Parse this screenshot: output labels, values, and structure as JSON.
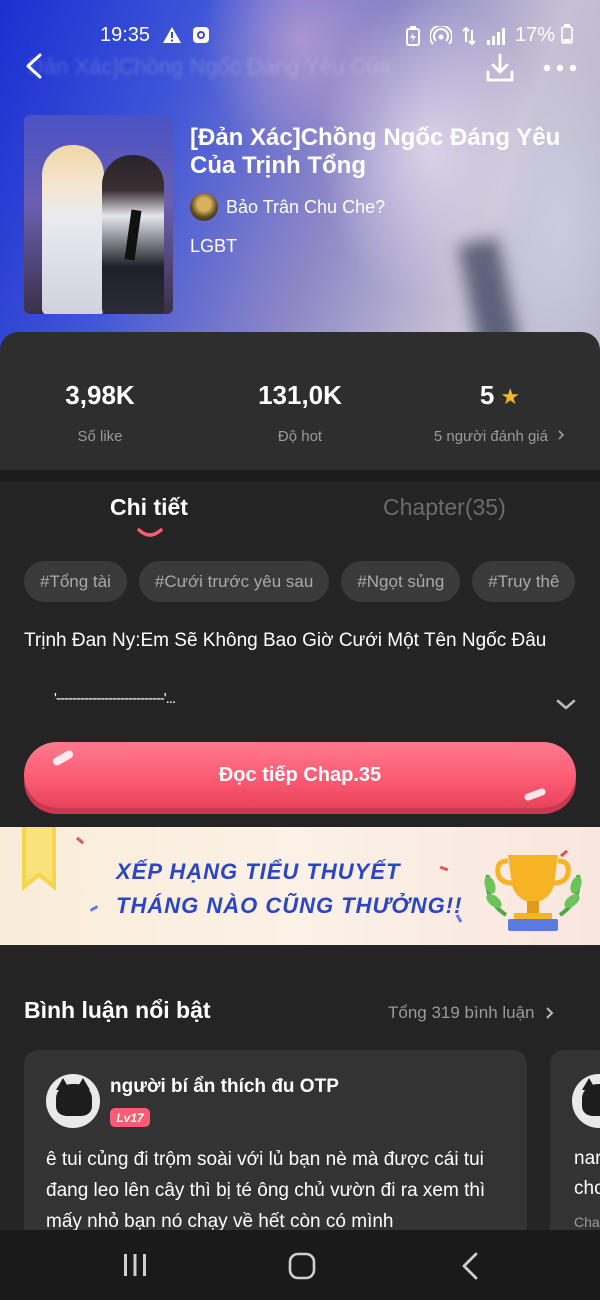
{
  "status_bar": {
    "time": "19:35",
    "battery": "17%",
    "icons": [
      "warning-icon",
      "notification-icon",
      "battery-saver-icon",
      "hotspot-icon",
      "data-icon",
      "signal-icon"
    ]
  },
  "header_ghost_title": "Đản Xác]Chồng Ngốc Đáng Yêu Của",
  "story": {
    "title": "[Đản Xác]Chồng Ngốc Đáng Yêu Của Trịnh Tổng",
    "author": "Bảo Trân Chu Che?",
    "genre": "LGBT"
  },
  "stats": {
    "likes_value": "3,98K",
    "likes_label": "Số like",
    "hot_value": "131,0K",
    "hot_label": "Độ hot",
    "rating_value": "5",
    "rating_label": "5 người đánh giá",
    "rating_fraction": 1.0
  },
  "tabs": {
    "detail": "Chi tiết",
    "chapter": "Chapter(35)"
  },
  "tags": [
    "#Tổng tài",
    "#Cưới trước yêu sau",
    "#Ngọt sủng",
    "#Truy thê"
  ],
  "description": {
    "line1": "Trịnh Đan Ny:Em Sẽ Không Bao Giờ Cưới Một Tên Ngốc Đâu",
    "line2": "'---------------------------'..."
  },
  "read_button": "Đọc tiếp Chap.35",
  "banner": {
    "line1": "XẾP HẠNG TIỂU THUYẾT",
    "line2": "THÁNG NÀO CŨNG THƯỞNG!!"
  },
  "comments": {
    "title": "Bình luận nổi bật",
    "total": "Tổng 319 bình luận",
    "items": [
      {
        "name": "người bí ẩn thích đu OTP",
        "level": "Lv17",
        "text": "ê tui củng đi trộm soài với lủ bạn nè mà được cái tui đang leo lên cây thì bị té ông chủ vườn đi ra xem thì mấy nhỏ bạn nó chạy về hết còn có mình"
      }
    ],
    "peek": {
      "line1": "nar",
      "line2": "cho",
      "line3": "Cha"
    }
  },
  "colors": {
    "accent": "#fb5c74",
    "star": "#f6b324",
    "banner_text": "#2a45c8",
    "background": "#242424"
  }
}
